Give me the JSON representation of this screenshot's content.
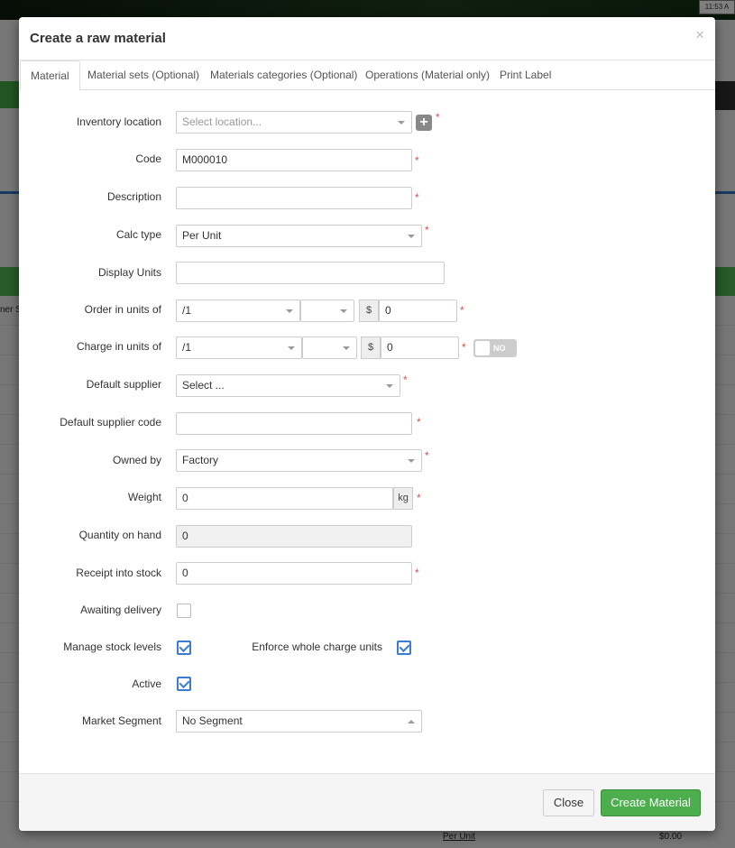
{
  "background": {
    "clock": "11:53 A",
    "column_fragment": "ner S",
    "footer_calc": "Per Unit",
    "footer_price": "$0.00"
  },
  "modal": {
    "title": "Create a raw material",
    "close_glyph": "×"
  },
  "tabs": [
    {
      "label": "Material",
      "active": true
    },
    {
      "label": "Material sets (Optional)"
    },
    {
      "label": "Materials categories (Optional)"
    },
    {
      "label": "Operations (Material only)"
    },
    {
      "label": "Print Label"
    }
  ],
  "form": {
    "inventory_location": {
      "label": "Inventory location",
      "placeholder": "Select location...",
      "add_glyph": "+"
    },
    "code": {
      "label": "Code",
      "value": "M000010"
    },
    "description": {
      "label": "Description",
      "value": ""
    },
    "calc_type": {
      "label": "Calc type",
      "value": "Per Unit"
    },
    "display_units": {
      "label": "Display Units",
      "value": ""
    },
    "order_units": {
      "label": "Order in units of",
      "unit": "/1",
      "currency": "$",
      "value": "0"
    },
    "charge_units": {
      "label": "Charge in units of",
      "unit": "/1",
      "currency": "$",
      "value": "0",
      "toggle": "NO"
    },
    "default_supplier": {
      "label": "Default supplier",
      "value": "Select ..."
    },
    "default_supplier_code": {
      "label": "Default supplier code",
      "value": ""
    },
    "owned_by": {
      "label": "Owned by",
      "value": "Factory"
    },
    "weight": {
      "label": "Weight",
      "value": "0",
      "unit": "kg"
    },
    "quantity_on_hand": {
      "label": "Quantity on hand",
      "value": "0"
    },
    "receipt_into_stock": {
      "label": "Receipt into stock",
      "value": "0"
    },
    "awaiting_delivery": {
      "label": "Awaiting delivery",
      "checked": false
    },
    "manage_stock_levels": {
      "label": "Manage stock levels",
      "checked": true
    },
    "enforce_whole_charge_units": {
      "label": "Enforce whole charge units",
      "checked": true
    },
    "active": {
      "label": "Active",
      "checked": true
    },
    "market_segment": {
      "label": "Market Segment",
      "value": "No Segment"
    },
    "required_mark": "*"
  },
  "footer": {
    "close_label": "Close",
    "create_label": "Create Material"
  },
  "colors": {
    "primary_green": "#4cae4c",
    "checkbox_blue": "#3a7bd5",
    "required_red": "#d9534f"
  }
}
